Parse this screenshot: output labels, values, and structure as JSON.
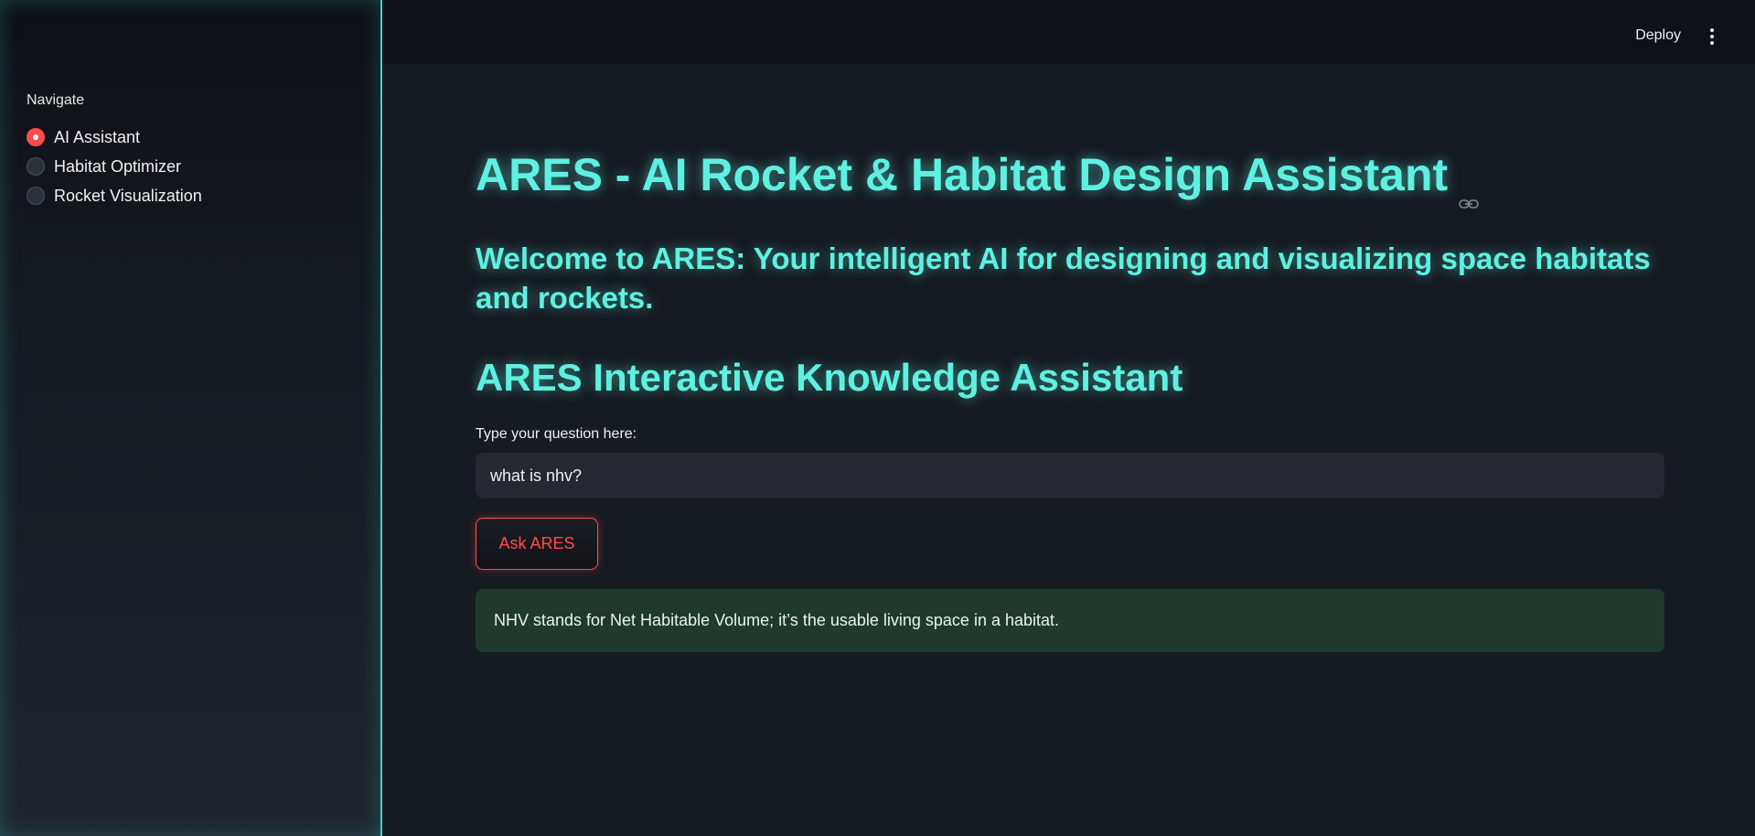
{
  "sidebar": {
    "nav_label": "Navigate",
    "items": [
      {
        "label": "AI Assistant",
        "selected": true
      },
      {
        "label": "Habitat Optimizer",
        "selected": false
      },
      {
        "label": "Rocket Visualization",
        "selected": false
      }
    ]
  },
  "header": {
    "deploy_label": "Deploy",
    "menu_icon": "vertical-dots-icon"
  },
  "main": {
    "title": "ARES - AI Rocket & Habitat Design Assistant",
    "title_icon": "link-icon",
    "welcome": "Welcome to ARES: Your intelligent AI for designing and visualizing space habitats and rockets.",
    "subheader": "ARES Interactive Knowledge Assistant",
    "input_label": "Type your question here:",
    "input_value": "what is nhv?",
    "ask_button": "Ask ARES",
    "answer": "NHV stands for Net Habitable Volume; it’s the usable living space in a habitat."
  },
  "colors": {
    "accent_cyan": "#5ff0e2",
    "accent_red": "#ff4b4b",
    "success_bg": "#1f3a2c"
  }
}
